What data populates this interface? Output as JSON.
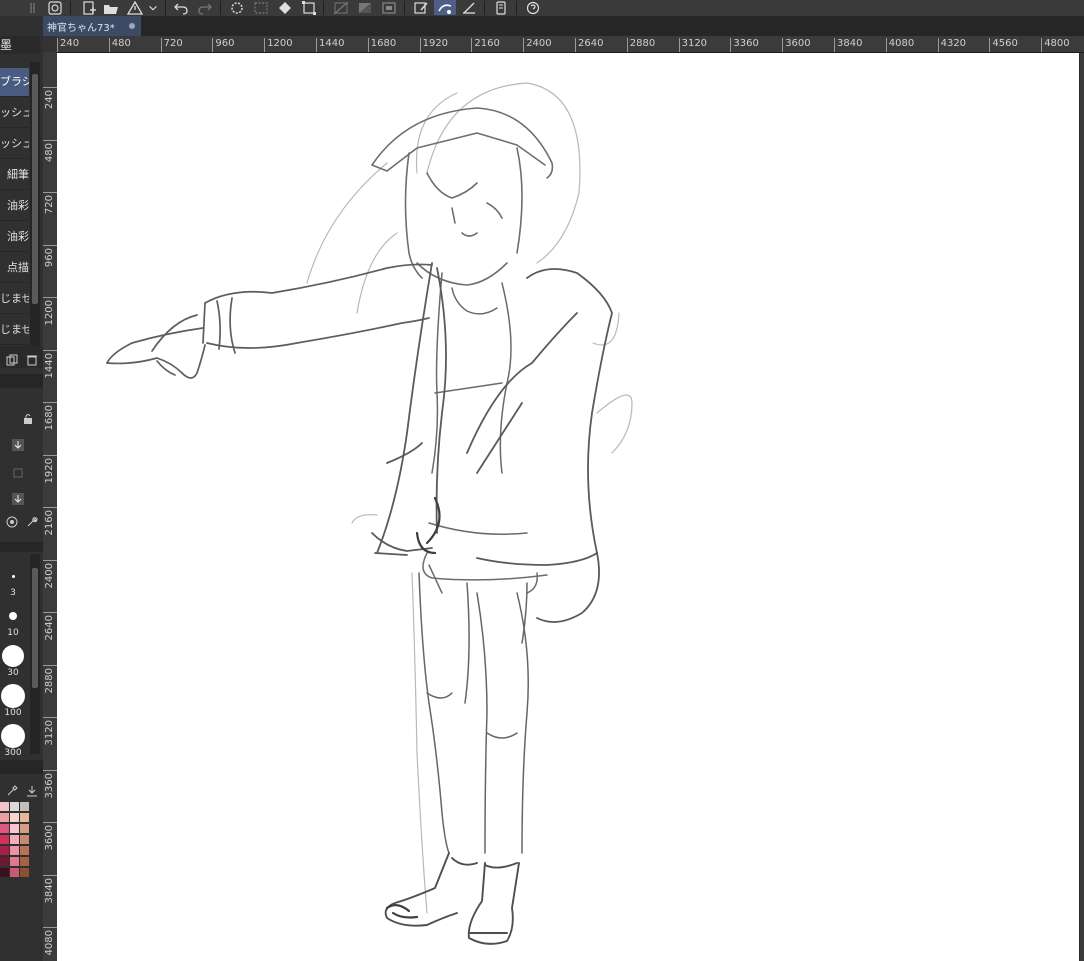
{
  "document": {
    "tab_title": "神官ちゃん73*"
  },
  "subtool_panel": {
    "header": "墨",
    "items": [
      {
        "label": "ブラシ",
        "selected": true
      },
      {
        "label": "ッシュ",
        "selected": false
      },
      {
        "label": "ッシュ",
        "selected": false
      },
      {
        "label": "細筆",
        "selected": false
      },
      {
        "label": "油彩",
        "selected": false
      },
      {
        "label": "油彩",
        "selected": false
      },
      {
        "label": "点描",
        "selected": false
      },
      {
        "label": "じませ",
        "selected": false
      },
      {
        "label": "じませ",
        "selected": false
      }
    ]
  },
  "brush_sizes": [
    "3",
    "10",
    "30",
    "100",
    "300"
  ],
  "ruler": {
    "horizontal": [
      "240",
      "480",
      "720",
      "960",
      "1200",
      "1440",
      "1680",
      "1920",
      "2160",
      "2400",
      "2640",
      "2880",
      "3120",
      "3360",
      "3600",
      "3840",
      "4080",
      "4320",
      "4560",
      "4800"
    ],
    "vertical": [
      "240",
      "480",
      "720",
      "960",
      "1200",
      "1440",
      "1680",
      "1920",
      "2160",
      "2400",
      "2640",
      "2880",
      "3120",
      "3360",
      "3600",
      "3840",
      "4080"
    ]
  },
  "colors": {
    "accent": "#4a5b82",
    "panel": "#303030",
    "paper": "#ffffff",
    "stroke": "#5f5f5f",
    "swatches": [
      "#f2c6c6",
      "#d9d9d9",
      "#bfbfbf",
      "#e8a0a0",
      "#f4d7c9",
      "#e7b79a",
      "#e05880",
      "#f7c9cf",
      "#d89e85",
      "#d0305a",
      "#f1aeba",
      "#c78a6d",
      "#a8204a",
      "#ea95a6",
      "#b87355",
      "#6a1b33",
      "#e27890",
      "#a66245",
      "#3a1020",
      "#c85a74",
      "#8e4e33"
    ]
  },
  "icons": {
    "toolbar": [
      "menu-grip-icon",
      "app-logo-icon",
      "new-file-icon",
      "open-folder-icon",
      "warning-icon",
      "undo-icon",
      "redo-icon",
      "loading-icon",
      "select-all-icon",
      "bucket-icon",
      "transform-icon",
      "ruler-icon",
      "layer-mask-icon",
      "fill-layer-icon",
      "pen-pressure-icon",
      "stabilizer-icon",
      "snap-icon",
      "device-icon",
      "help-icon"
    ]
  }
}
